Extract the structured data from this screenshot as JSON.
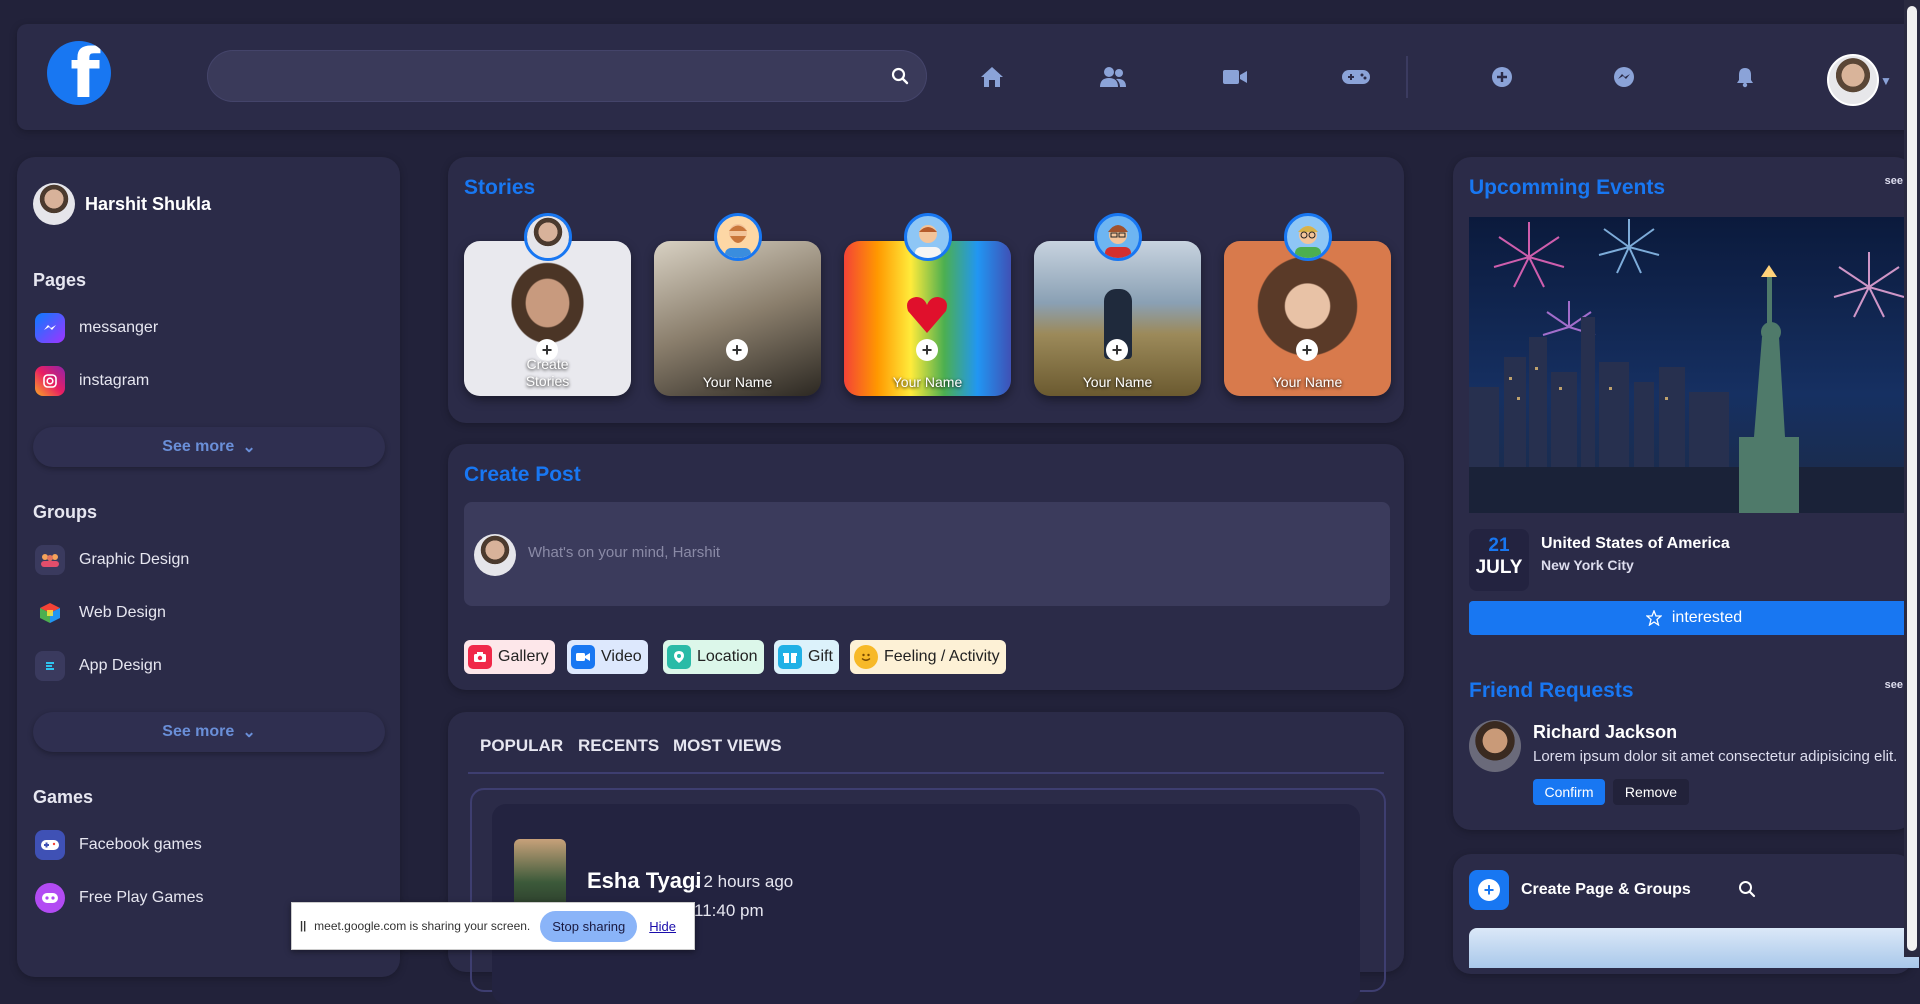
{
  "colors": {
    "accent": "#1877f2",
    "background": "#22223a",
    "card": "#2b2b48"
  },
  "topnav": {
    "logo_letter": "f",
    "search": {
      "placeholder": "",
      "icon": "search-icon"
    },
    "icons": [
      "home-icon",
      "friends-icon",
      "video-icon",
      "gaming-icon",
      "add-icon",
      "messenger-icon",
      "bell-icon"
    ]
  },
  "sidebar": {
    "user_name": "Harshit Shukla",
    "pages_title": "Pages",
    "pages": [
      {
        "label": "messanger",
        "icon": "messenger-icon"
      },
      {
        "label": "instagram",
        "icon": "instagram-icon"
      }
    ],
    "pages_see_more": "See more",
    "groups_title": "Groups",
    "groups": [
      {
        "label": "Graphic Design",
        "icon": "group-icon"
      },
      {
        "label": "Web Design",
        "icon": "cube-icon"
      },
      {
        "label": "App Design",
        "icon": "app-icon"
      }
    ],
    "groups_see_more": "See more",
    "games_title": "Games",
    "games": [
      {
        "label": "Facebook games",
        "icon": "gamepad-icon"
      },
      {
        "label": "Free Play Games",
        "icon": "game-icon"
      }
    ]
  },
  "stories": {
    "title": "Stories",
    "items": [
      {
        "label_line1": "Create",
        "label_line2": "Stories"
      },
      {
        "label": "Your Name"
      },
      {
        "label": "Your Name"
      },
      {
        "label": "Your Name"
      },
      {
        "label": "Your Name"
      }
    ]
  },
  "create_post": {
    "title": "Create Post",
    "placeholder": "What's on your mind, Harshit",
    "actions": [
      {
        "label": "Gallery",
        "icon": "camera-icon",
        "bg": "#fde7ea",
        "color": "#f02849"
      },
      {
        "label": "Video",
        "icon": "video-icon",
        "bg": "#dde8fd",
        "color": "#1877f2"
      },
      {
        "label": "Location",
        "icon": "location-icon",
        "bg": "#dcf7ea",
        "color": "#2abba7"
      },
      {
        "label": "Gift",
        "icon": "gift-icon",
        "bg": "#dcf2fb",
        "color": "#21b1e6"
      },
      {
        "label": "Feeling / Activity",
        "icon": "smile-icon",
        "bg": "#fdf1d6",
        "color": "#f7b928"
      }
    ]
  },
  "feed": {
    "tabs": [
      "POPULAR",
      "RECENTS",
      "MOST VIEWS"
    ],
    "post": {
      "user": "Esha Tyagi",
      "time": ". 2 hours ago",
      "subline": "11:40 pm"
    }
  },
  "events": {
    "title": "Upcomming Events",
    "see_all": "see",
    "day": "21",
    "month": "JULY",
    "place": "United States of America",
    "city": "New York City",
    "button": "interested"
  },
  "friend_requests": {
    "title": "Friend Requests",
    "see_all": "see",
    "name": "Richard Jackson",
    "text": "Lorem ipsum dolor sit amet consectetur adipisicing elit.",
    "confirm": "Confirm",
    "remove": "Remove"
  },
  "pages_groups": {
    "title": "Create Page & Groups"
  },
  "share_bar": {
    "message": "meet.google.com is sharing your screen.",
    "stop": "Stop sharing",
    "hide": "Hide",
    "pause": "||"
  }
}
